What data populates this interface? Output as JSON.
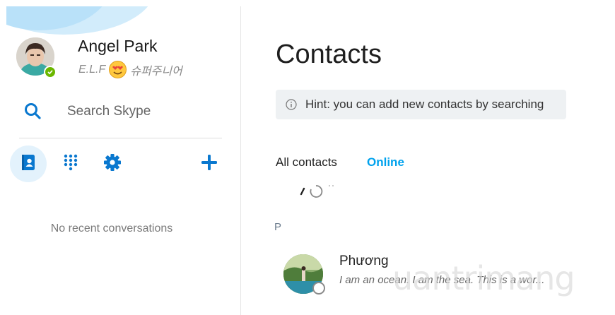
{
  "profile": {
    "name": "Angel Park",
    "mood_prefix": "E.L.F",
    "mood_suffix": "슈퍼주니어",
    "status": "online"
  },
  "search": {
    "label": "Search Skype"
  },
  "nav": {
    "contacts": "contacts-icon",
    "dialpad": "dialpad-icon",
    "settings": "gear-icon",
    "add": "plus-icon"
  },
  "recent": {
    "empty_text": "No recent conversations"
  },
  "main": {
    "title": "Contacts",
    "hint": "Hint: you can add new contacts by searching",
    "tabs": [
      {
        "label": "All contacts",
        "active": true
      },
      {
        "label": "Online",
        "active": false
      }
    ],
    "group_letter": "P",
    "contacts": [
      {
        "name": "Phương",
        "mood": "I am an ocean. I am the sea. This is a wor..."
      }
    ]
  },
  "watermark": "uantrimang",
  "colors": {
    "accent": "#00a2ed",
    "online": "#6bb700",
    "sidebar_wave": "#b9e1f9"
  }
}
